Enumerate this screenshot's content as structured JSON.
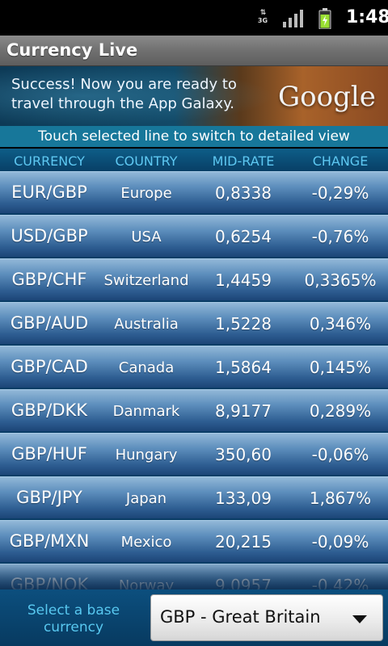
{
  "status_bar": {
    "network_label": "3G",
    "time": "1:48",
    "icons": [
      "data-arrows-icon",
      "signal-bars-icon",
      "battery-charging-icon"
    ],
    "battery_color": "#9ae033"
  },
  "app": {
    "title": "Currency Live"
  },
  "ad_banner": {
    "text": "Success! Now you are ready to travel through the App Galaxy.",
    "logo": "Google"
  },
  "hint": "Touch selected line to switch to detailed view",
  "table": {
    "columns": [
      "CURRENCY",
      "COUNTRY",
      "MID-RATE",
      "CHANGE"
    ],
    "rows": [
      {
        "pair": "EUR/GBP",
        "country": "Europe",
        "rate": "0,8338",
        "change": "-0,29%"
      },
      {
        "pair": "USD/GBP",
        "country": "USA",
        "rate": "0,6254",
        "change": "-0,76%"
      },
      {
        "pair": "GBP/CHF",
        "country": "Switzerland",
        "rate": "1,4459",
        "change": "0,3365%"
      },
      {
        "pair": "GBP/AUD",
        "country": "Australia",
        "rate": "1,5228",
        "change": "0,346%"
      },
      {
        "pair": "GBP/CAD",
        "country": "Canada",
        "rate": "1,5864",
        "change": "0,145%"
      },
      {
        "pair": "GBP/DKK",
        "country": "Danmark",
        "rate": "8,9177",
        "change": "0,289%"
      },
      {
        "pair": "GBP/HUF",
        "country": "Hungary",
        "rate": "350,60",
        "change": "-0,06%"
      },
      {
        "pair": "GBP/JPY",
        "country": "Japan",
        "rate": "133,09",
        "change": "1,867%"
      },
      {
        "pair": "GBP/MXN",
        "country": "Mexico",
        "rate": "20,215",
        "change": "-0,09%"
      },
      {
        "pair": "GBP/NOK",
        "country": "Norway",
        "rate": "9,0957",
        "change": "-0,42%"
      }
    ]
  },
  "base_currency": {
    "label": "Select a base currency",
    "selected": "GBP - Great Britain"
  },
  "colors": {
    "hint_bg": "#17779a",
    "header_text": "#5ec8f2",
    "row_gradient_top": "#92b8d8",
    "row_gradient_bottom": "#1c4577"
  }
}
